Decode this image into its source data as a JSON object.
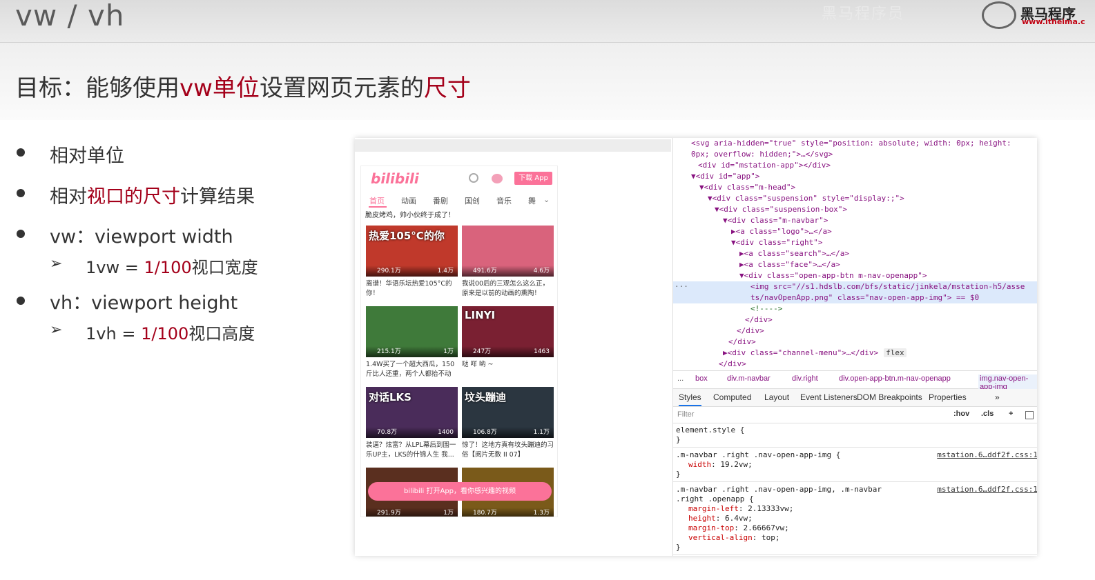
{
  "header": {
    "title": "vw / vh",
    "watermark": "黑马程序员",
    "brand": "黑马程序",
    "url": "www.itheima.c"
  },
  "goal": {
    "prefix": "目标：能够使用",
    "em1": "vw单位",
    "mid": "设置网页元素的",
    "em2": "尺寸"
  },
  "bullets": {
    "b1": "相对单位",
    "b2_pre": "相对",
    "b2_em": "视口的尺寸",
    "b2_post": "计算结果",
    "b3": "vw：viewport width",
    "b3s_pre": "1vw = ",
    "b3s_em": "1/100",
    "b3s_post": "视口宽度",
    "b4": "vh：viewport height",
    "b4s_pre": "1vh = ",
    "b4s_em": "1/100",
    "b4s_post": "视口高度",
    "arrow": "➢"
  },
  "phone": {
    "logo": "bilibili",
    "open_app": "下载 App",
    "tabs": [
      "首页",
      "动画",
      "番剧",
      "国创",
      "音乐",
      "舞"
    ],
    "snippet": "脆皮烤鸡，帅小伙终于成了！",
    "videos": [
      {
        "thumb_text": "热爱105°C的你",
        "plays": "290.1万",
        "danmaku": "1.4万",
        "caption": "离谱！华语乐坛热爱105°C的你！",
        "bg": "#c0392b"
      },
      {
        "thumb_text": "",
        "plays": "491.6万",
        "danmaku": "4.6万",
        "caption": "我说00后的三观怎么这么正，原来是以前的动画的熏陶！",
        "bg": "#d9637c"
      },
      {
        "thumb_text": "",
        "plays": "215.1万",
        "danmaku": "1万",
        "caption": "1.4W买了一个超大西瓜，150斤比人还重，两个人都抬不动",
        "bg": "#3f7a3a"
      },
      {
        "thumb_text": "LINYI",
        "plays": "247万",
        "danmaku": "1463",
        "caption": "哒 咩 哟 ~",
        "bg": "#7a2032"
      },
      {
        "thumb_text": "对话LKS",
        "plays": "70.8万",
        "danmaku": "1400",
        "caption": "装逼？炫富？从LPL幕后到围一乐UP主，LKS的什锦人生 我...",
        "bg": "#4a2c5a"
      },
      {
        "thumb_text": "坟头蹦迪",
        "plays": "106.8万",
        "danmaku": "1.1万",
        "caption": "惊了！这地方真有坟头蹦迪的习俗【阅片无数 II 07】",
        "bg": "#2b3640"
      },
      {
        "thumb_text": "",
        "plays": "291.9万",
        "danmaku": "1万",
        "caption": "",
        "bg": "#5a2f1f"
      },
      {
        "thumb_text": "",
        "plays": "180.7万",
        "danmaku": "1.3万",
        "caption": "",
        "bg": "#7a5a1a"
      }
    ],
    "banner": "bilibili  打开App，看你感兴趣的视频"
  },
  "devtools": {
    "lines": [
      {
        "t": "  <svg aria-hidden=\"true\" style=\"position: absolute; width: 0px; height:"
      },
      {
        "t": "0px; overflow: hidden;\">…</svg>"
      },
      {
        "t": "<div id=\"mstation-app\"></div>"
      },
      {
        "t": "▼<div id=\"app\">"
      },
      {
        "t": "▼<div class=\"m-head\">"
      },
      {
        "t": "▼<div class=\"suspension\" style=\"display:;\">"
      },
      {
        "t": "▼<div class=\"suspension-box\">"
      },
      {
        "t": "▼<div class=\"m-navbar\">"
      },
      {
        "t": "▶<a class=\"logo\">…</a>"
      },
      {
        "t": "▼<div class=\"right\">"
      },
      {
        "t": "▶<a class=\"search\">…</a>"
      },
      {
        "t": "▶<a class=\"face\">…</a>"
      },
      {
        "t": "▼<div class=\"open-app-btn m-nav-openapp\">"
      },
      {
        "t": "<img src=\"//s1.hdslb.com/bfs/static/jinkela/mstation-h5/asse"
      },
      {
        "t": "ts/navOpenApp.png\" class=\"nav-open-app-img\"> == $0"
      },
      {
        "t": "<!---->"
      },
      {
        "t": "</div>"
      },
      {
        "t": "</div>"
      },
      {
        "t": "</div>"
      },
      {
        "t": "▶<div class=\"channel-menu\">…</div>"
      },
      {
        "t": "flex"
      },
      {
        "t": "</div>"
      }
    ],
    "crumbs": [
      "...",
      "box",
      "div.m-navbar",
      "div.right",
      "div.open-app-btn.m-nav-openapp",
      "img.nav-open-app-img",
      "..."
    ],
    "tabs": [
      "Styles",
      "Computed",
      "Layout",
      "Event Listeners",
      "DOM Breakpoints",
      "Properties",
      "»"
    ],
    "filter_placeholder": "Filter",
    "filter_buttons": [
      ":hov",
      ".cls",
      "+"
    ],
    "rules": [
      {
        "sel": "element.style {",
        "props": [],
        "src": ""
      },
      {
        "sel": ".m-navbar .right .nav-open-app-img {",
        "props": [
          [
            "width",
            "19.2vw"
          ]
        ],
        "src": "mstation.6…ddf2f.css:1"
      },
      {
        "sel": ".m-navbar .right .nav-open-app-img, .m-navbar",
        "sel2": ".right .openapp {",
        "props": [
          [
            "margin-left",
            "2.13333vw"
          ],
          [
            "height",
            "6.4vw"
          ],
          [
            "margin-top",
            "2.66667vw"
          ],
          [
            "vertical-align",
            "top"
          ]
        ],
        "src": "mstation.6…ddf2f.css:1"
      }
    ],
    "close_brace": "}"
  }
}
